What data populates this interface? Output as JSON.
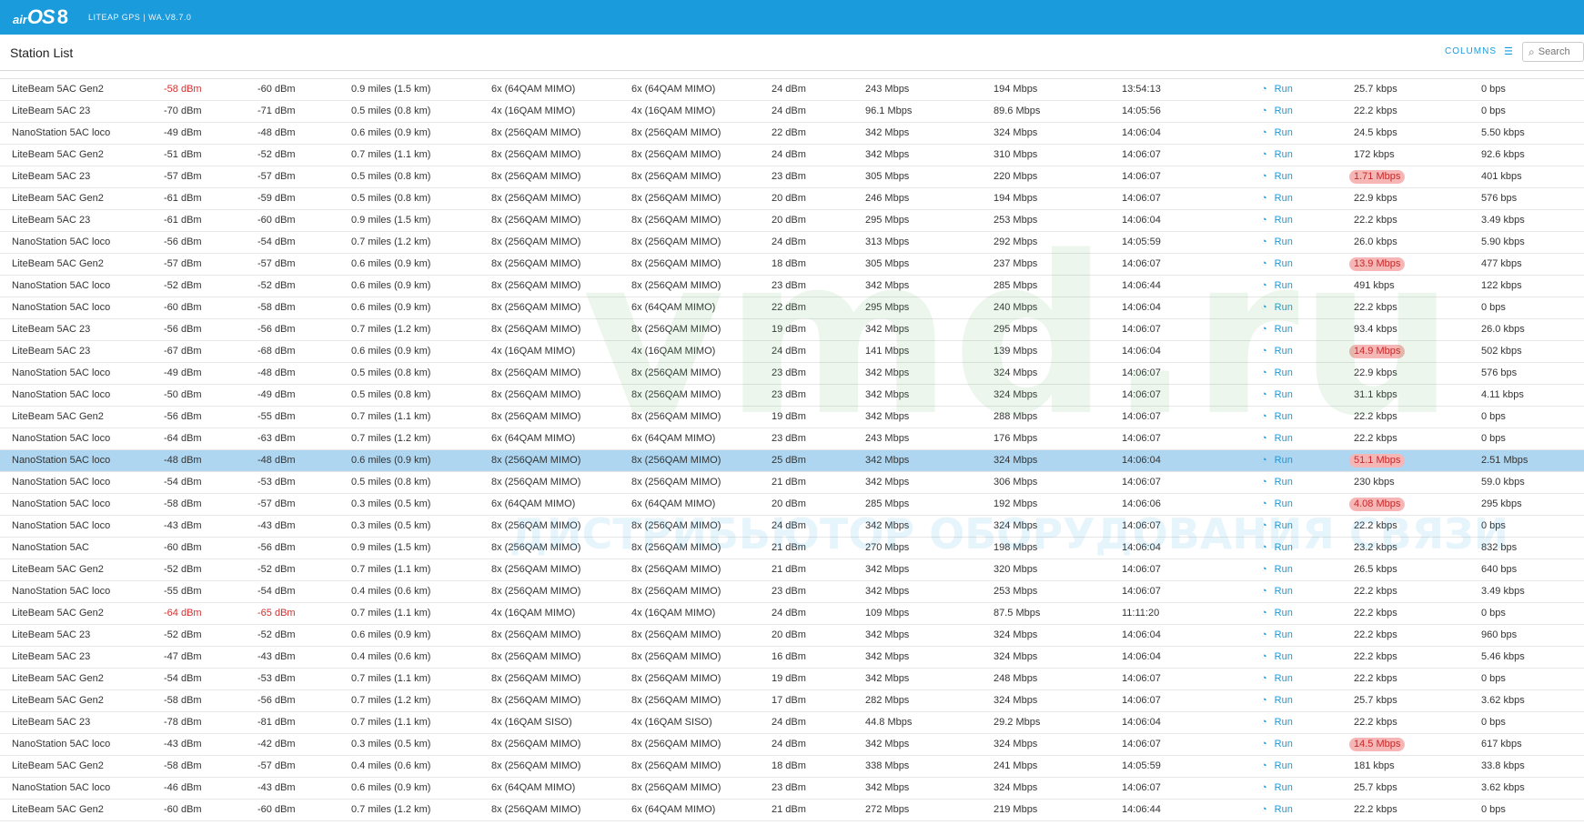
{
  "header": {
    "logo_brand": "air",
    "logo_os": "OS",
    "logo_version": "8",
    "product": "LITEAP GPS | WA.V8.7.0"
  },
  "page": {
    "title": "Station List",
    "columns_label": "COLUMNS",
    "search_placeholder": "Search"
  },
  "watermark": {
    "domain": "vmd.ru",
    "tagline": "ДИСТРИБЬЮТОР ОБОРУДОВАНИЯ СВЯЗИ"
  },
  "colors": {
    "accent": "#1a9bdc",
    "selected_row": "#aed6f1",
    "alert": "#d32f2f",
    "highlight_bg": "#f7b6b6"
  },
  "rows": [
    {
      "name": "LiteBeam 5AC Gen2",
      "sig": "-58 dBm",
      "rsig": "-60 dBm",
      "dist": "0.9 miles (1.5 km)",
      "rxm": "6x (64QAM MIMO)",
      "txm": "6x (64QAM MIMO)",
      "txp": "24 dBm",
      "txr": "243 Mbps",
      "rxr": "194 Mbps",
      "last": "13:54:13",
      "run": "Run",
      "thr": "25.7 kbps",
      "thr2": "0 bps",
      "sig_red": true,
      "rsig_red": false,
      "thr_hl": false,
      "selected": false
    },
    {
      "name": "LiteBeam 5AC 23",
      "sig": "-70 dBm",
      "rsig": "-71 dBm",
      "dist": "0.5 miles (0.8 km)",
      "rxm": "4x (16QAM MIMO)",
      "txm": "4x (16QAM MIMO)",
      "txp": "24 dBm",
      "txr": "96.1 Mbps",
      "rxr": "89.6 Mbps",
      "last": "14:05:56",
      "run": "Run",
      "thr": "22.2 kbps",
      "thr2": "0 bps",
      "sig_red": false,
      "rsig_red": false,
      "thr_hl": false,
      "selected": false
    },
    {
      "name": "NanoStation 5AC loco",
      "sig": "-49 dBm",
      "rsig": "-48 dBm",
      "dist": "0.6 miles (0.9 km)",
      "rxm": "8x (256QAM MIMO)",
      "txm": "8x (256QAM MIMO)",
      "txp": "22 dBm",
      "txr": "342 Mbps",
      "rxr": "324 Mbps",
      "last": "14:06:04",
      "run": "Run",
      "thr": "24.5 kbps",
      "thr2": "5.50 kbps",
      "sig_red": false,
      "rsig_red": false,
      "thr_hl": false,
      "selected": false
    },
    {
      "name": "LiteBeam 5AC Gen2",
      "sig": "-51 dBm",
      "rsig": "-52 dBm",
      "dist": "0.7 miles (1.1 km)",
      "rxm": "8x (256QAM MIMO)",
      "txm": "8x (256QAM MIMO)",
      "txp": "24 dBm",
      "txr": "342 Mbps",
      "rxr": "310 Mbps",
      "last": "14:06:07",
      "run": "Run",
      "thr": "172 kbps",
      "thr2": "92.6 kbps",
      "sig_red": false,
      "rsig_red": false,
      "thr_hl": false,
      "selected": false
    },
    {
      "name": "LiteBeam 5AC 23",
      "sig": "-57 dBm",
      "rsig": "-57 dBm",
      "dist": "0.5 miles (0.8 km)",
      "rxm": "8x (256QAM MIMO)",
      "txm": "8x (256QAM MIMO)",
      "txp": "23 dBm",
      "txr": "305 Mbps",
      "rxr": "220 Mbps",
      "last": "14:06:07",
      "run": "Run",
      "thr": "1.71 Mbps",
      "thr2": "401 kbps",
      "sig_red": false,
      "rsig_red": false,
      "thr_hl": true,
      "selected": false
    },
    {
      "name": "LiteBeam 5AC Gen2",
      "sig": "-61 dBm",
      "rsig": "-59 dBm",
      "dist": "0.5 miles (0.8 km)",
      "rxm": "8x (256QAM MIMO)",
      "txm": "8x (256QAM MIMO)",
      "txp": "20 dBm",
      "txr": "246 Mbps",
      "rxr": "194 Mbps",
      "last": "14:06:07",
      "run": "Run",
      "thr": "22.9 kbps",
      "thr2": "576 bps",
      "sig_red": false,
      "rsig_red": false,
      "thr_hl": false,
      "selected": false
    },
    {
      "name": "LiteBeam 5AC 23",
      "sig": "-61 dBm",
      "rsig": "-60 dBm",
      "dist": "0.9 miles (1.5 km)",
      "rxm": "8x (256QAM MIMO)",
      "txm": "8x (256QAM MIMO)",
      "txp": "20 dBm",
      "txr": "295 Mbps",
      "rxr": "253 Mbps",
      "last": "14:06:04",
      "run": "Run",
      "thr": "22.2 kbps",
      "thr2": "3.49 kbps",
      "sig_red": false,
      "rsig_red": false,
      "thr_hl": false,
      "selected": false
    },
    {
      "name": "NanoStation 5AC loco",
      "sig": "-56 dBm",
      "rsig": "-54 dBm",
      "dist": "0.7 miles (1.2 km)",
      "rxm": "8x (256QAM MIMO)",
      "txm": "8x (256QAM MIMO)",
      "txp": "24 dBm",
      "txr": "313 Mbps",
      "rxr": "292 Mbps",
      "last": "14:05:59",
      "run": "Run",
      "thr": "26.0 kbps",
      "thr2": "5.90 kbps",
      "sig_red": false,
      "rsig_red": false,
      "thr_hl": false,
      "selected": false
    },
    {
      "name": "LiteBeam 5AC Gen2",
      "sig": "-57 dBm",
      "rsig": "-57 dBm",
      "dist": "0.6 miles (0.9 km)",
      "rxm": "8x (256QAM MIMO)",
      "txm": "8x (256QAM MIMO)",
      "txp": "18 dBm",
      "txr": "305 Mbps",
      "rxr": "237 Mbps",
      "last": "14:06:07",
      "run": "Run",
      "thr": "13.9 Mbps",
      "thr2": "477 kbps",
      "sig_red": false,
      "rsig_red": false,
      "thr_hl": true,
      "selected": false
    },
    {
      "name": "NanoStation 5AC loco",
      "sig": "-52 dBm",
      "rsig": "-52 dBm",
      "dist": "0.6 miles (0.9 km)",
      "rxm": "8x (256QAM MIMO)",
      "txm": "8x (256QAM MIMO)",
      "txp": "23 dBm",
      "txr": "342 Mbps",
      "rxr": "285 Mbps",
      "last": "14:06:44",
      "run": "Run",
      "thr": "491 kbps",
      "thr2": "122 kbps",
      "sig_red": false,
      "rsig_red": false,
      "thr_hl": false,
      "selected": false
    },
    {
      "name": "NanoStation 5AC loco",
      "sig": "-60 dBm",
      "rsig": "-58 dBm",
      "dist": "0.6 miles (0.9 km)",
      "rxm": "8x (256QAM MIMO)",
      "txm": "6x (64QAM MIMO)",
      "txp": "22 dBm",
      "txr": "295 Mbps",
      "rxr": "240 Mbps",
      "last": "14:06:04",
      "run": "Run",
      "thr": "22.2 kbps",
      "thr2": "0 bps",
      "sig_red": false,
      "rsig_red": false,
      "thr_hl": false,
      "selected": false
    },
    {
      "name": "LiteBeam 5AC 23",
      "sig": "-56 dBm",
      "rsig": "-56 dBm",
      "dist": "0.7 miles (1.2 km)",
      "rxm": "8x (256QAM MIMO)",
      "txm": "8x (256QAM MIMO)",
      "txp": "19 dBm",
      "txr": "342 Mbps",
      "rxr": "295 Mbps",
      "last": "14:06:07",
      "run": "Run",
      "thr": "93.4 kbps",
      "thr2": "26.0 kbps",
      "sig_red": false,
      "rsig_red": false,
      "thr_hl": false,
      "selected": false
    },
    {
      "name": "LiteBeam 5AC 23",
      "sig": "-67 dBm",
      "rsig": "-68 dBm",
      "dist": "0.6 miles (0.9 km)",
      "rxm": "4x (16QAM MIMO)",
      "txm": "4x (16QAM MIMO)",
      "txp": "24 dBm",
      "txr": "141 Mbps",
      "rxr": "139 Mbps",
      "last": "14:06:04",
      "run": "Run",
      "thr": "14.9 Mbps",
      "thr2": "502 kbps",
      "sig_red": false,
      "rsig_red": false,
      "thr_hl": true,
      "selected": false
    },
    {
      "name": "NanoStation 5AC loco",
      "sig": "-49 dBm",
      "rsig": "-48 dBm",
      "dist": "0.5 miles (0.8 km)",
      "rxm": "8x (256QAM MIMO)",
      "txm": "8x (256QAM MIMO)",
      "txp": "23 dBm",
      "txr": "342 Mbps",
      "rxr": "324 Mbps",
      "last": "14:06:07",
      "run": "Run",
      "thr": "22.9 kbps",
      "thr2": "576 bps",
      "sig_red": false,
      "rsig_red": false,
      "thr_hl": false,
      "selected": false
    },
    {
      "name": "NanoStation 5AC loco",
      "sig": "-50 dBm",
      "rsig": "-49 dBm",
      "dist": "0.5 miles (0.8 km)",
      "rxm": "8x (256QAM MIMO)",
      "txm": "8x (256QAM MIMO)",
      "txp": "23 dBm",
      "txr": "342 Mbps",
      "rxr": "324 Mbps",
      "last": "14:06:07",
      "run": "Run",
      "thr": "31.1 kbps",
      "thr2": "4.11 kbps",
      "sig_red": false,
      "rsig_red": false,
      "thr_hl": false,
      "selected": false
    },
    {
      "name": "LiteBeam 5AC Gen2",
      "sig": "-56 dBm",
      "rsig": "-55 dBm",
      "dist": "0.7 miles (1.1 km)",
      "rxm": "8x (256QAM MIMO)",
      "txm": "8x (256QAM MIMO)",
      "txp": "19 dBm",
      "txr": "342 Mbps",
      "rxr": "288 Mbps",
      "last": "14:06:07",
      "run": "Run",
      "thr": "22.2 kbps",
      "thr2": "0 bps",
      "sig_red": false,
      "rsig_red": false,
      "thr_hl": false,
      "selected": false
    },
    {
      "name": "NanoStation 5AC loco",
      "sig": "-64 dBm",
      "rsig": "-63 dBm",
      "dist": "0.7 miles (1.2 km)",
      "rxm": "6x (64QAM MIMO)",
      "txm": "6x (64QAM MIMO)",
      "txp": "23 dBm",
      "txr": "243 Mbps",
      "rxr": "176 Mbps",
      "last": "14:06:07",
      "run": "Run",
      "thr": "22.2 kbps",
      "thr2": "0 bps",
      "sig_red": false,
      "rsig_red": false,
      "thr_hl": false,
      "selected": false
    },
    {
      "name": "NanoStation 5AC loco",
      "sig": "-48 dBm",
      "rsig": "-48 dBm",
      "dist": "0.6 miles (0.9 km)",
      "rxm": "8x (256QAM MIMO)",
      "txm": "8x (256QAM MIMO)",
      "txp": "25 dBm",
      "txr": "342 Mbps",
      "rxr": "324 Mbps",
      "last": "14:06:04",
      "run": "Run",
      "thr": "51.1 Mbps",
      "thr2": "2.51 Mbps",
      "sig_red": false,
      "rsig_red": false,
      "thr_hl": true,
      "selected": true
    },
    {
      "name": "NanoStation 5AC loco",
      "sig": "-54 dBm",
      "rsig": "-53 dBm",
      "dist": "0.5 miles (0.8 km)",
      "rxm": "8x (256QAM MIMO)",
      "txm": "8x (256QAM MIMO)",
      "txp": "21 dBm",
      "txr": "342 Mbps",
      "rxr": "306 Mbps",
      "last": "14:06:07",
      "run": "Run",
      "thr": "230 kbps",
      "thr2": "59.0 kbps",
      "sig_red": false,
      "rsig_red": false,
      "thr_hl": false,
      "selected": false
    },
    {
      "name": "NanoStation 5AC loco",
      "sig": "-58 dBm",
      "rsig": "-57 dBm",
      "dist": "0.3 miles (0.5 km)",
      "rxm": "6x (64QAM MIMO)",
      "txm": "6x (64QAM MIMO)",
      "txp": "20 dBm",
      "txr": "285 Mbps",
      "rxr": "192 Mbps",
      "last": "14:06:06",
      "run": "Run",
      "thr": "4.08 Mbps",
      "thr2": "295 kbps",
      "sig_red": false,
      "rsig_red": false,
      "thr_hl": true,
      "selected": false
    },
    {
      "name": "NanoStation 5AC loco",
      "sig": "-43 dBm",
      "rsig": "-43 dBm",
      "dist": "0.3 miles (0.5 km)",
      "rxm": "8x (256QAM MIMO)",
      "txm": "8x (256QAM MIMO)",
      "txp": "24 dBm",
      "txr": "342 Mbps",
      "rxr": "324 Mbps",
      "last": "14:06:07",
      "run": "Run",
      "thr": "22.2 kbps",
      "thr2": "0 bps",
      "sig_red": false,
      "rsig_red": false,
      "thr_hl": false,
      "selected": false
    },
    {
      "name": "NanoStation 5AC",
      "sig": "-60 dBm",
      "rsig": "-56 dBm",
      "dist": "0.9 miles (1.5 km)",
      "rxm": "8x (256QAM MIMO)",
      "txm": "8x (256QAM MIMO)",
      "txp": "21 dBm",
      "txr": "270 Mbps",
      "rxr": "198 Mbps",
      "last": "14:06:04",
      "run": "Run",
      "thr": "23.2 kbps",
      "thr2": "832 bps",
      "sig_red": false,
      "rsig_red": false,
      "thr_hl": false,
      "selected": false
    },
    {
      "name": "LiteBeam 5AC Gen2",
      "sig": "-52 dBm",
      "rsig": "-52 dBm",
      "dist": "0.7 miles (1.1 km)",
      "rxm": "8x (256QAM MIMO)",
      "txm": "8x (256QAM MIMO)",
      "txp": "21 dBm",
      "txr": "342 Mbps",
      "rxr": "320 Mbps",
      "last": "14:06:07",
      "run": "Run",
      "thr": "26.5 kbps",
      "thr2": "640 bps",
      "sig_red": false,
      "rsig_red": false,
      "thr_hl": false,
      "selected": false
    },
    {
      "name": "NanoStation 5AC loco",
      "sig": "-55 dBm",
      "rsig": "-54 dBm",
      "dist": "0.4 miles (0.6 km)",
      "rxm": "8x (256QAM MIMO)",
      "txm": "8x (256QAM MIMO)",
      "txp": "23 dBm",
      "txr": "342 Mbps",
      "rxr": "253 Mbps",
      "last": "14:06:07",
      "run": "Run",
      "thr": "22.2 kbps",
      "thr2": "3.49 kbps",
      "sig_red": false,
      "rsig_red": false,
      "thr_hl": false,
      "selected": false
    },
    {
      "name": "LiteBeam 5AC Gen2",
      "sig": "-64 dBm",
      "rsig": "-65 dBm",
      "dist": "0.7 miles (1.1 km)",
      "rxm": "4x (16QAM MIMO)",
      "txm": "4x (16QAM MIMO)",
      "txp": "24 dBm",
      "txr": "109 Mbps",
      "rxr": "87.5 Mbps",
      "last": "11:11:20",
      "run": "Run",
      "thr": "22.2 kbps",
      "thr2": "0 bps",
      "sig_red": true,
      "rsig_red": true,
      "thr_hl": false,
      "selected": false
    },
    {
      "name": "LiteBeam 5AC 23",
      "sig": "-52 dBm",
      "rsig": "-52 dBm",
      "dist": "0.6 miles (0.9 km)",
      "rxm": "8x (256QAM MIMO)",
      "txm": "8x (256QAM MIMO)",
      "txp": "20 dBm",
      "txr": "342 Mbps",
      "rxr": "324 Mbps",
      "last": "14:06:04",
      "run": "Run",
      "thr": "22.2 kbps",
      "thr2": "960 bps",
      "sig_red": false,
      "rsig_red": false,
      "thr_hl": false,
      "selected": false
    },
    {
      "name": "LiteBeam 5AC 23",
      "sig": "-47 dBm",
      "rsig": "-43 dBm",
      "dist": "0.4 miles (0.6 km)",
      "rxm": "8x (256QAM MIMO)",
      "txm": "8x (256QAM MIMO)",
      "txp": "16 dBm",
      "txr": "342 Mbps",
      "rxr": "324 Mbps",
      "last": "14:06:04",
      "run": "Run",
      "thr": "22.2 kbps",
      "thr2": "5.46 kbps",
      "sig_red": false,
      "rsig_red": false,
      "thr_hl": false,
      "selected": false
    },
    {
      "name": "LiteBeam 5AC Gen2",
      "sig": "-54 dBm",
      "rsig": "-53 dBm",
      "dist": "0.7 miles (1.1 km)",
      "rxm": "8x (256QAM MIMO)",
      "txm": "8x (256QAM MIMO)",
      "txp": "19 dBm",
      "txr": "342 Mbps",
      "rxr": "248 Mbps",
      "last": "14:06:07",
      "run": "Run",
      "thr": "22.2 kbps",
      "thr2": "0 bps",
      "sig_red": false,
      "rsig_red": false,
      "thr_hl": false,
      "selected": false
    },
    {
      "name": "LiteBeam 5AC Gen2",
      "sig": "-58 dBm",
      "rsig": "-56 dBm",
      "dist": "0.7 miles (1.2 km)",
      "rxm": "8x (256QAM MIMO)",
      "txm": "8x (256QAM MIMO)",
      "txp": "17 dBm",
      "txr": "282 Mbps",
      "rxr": "324 Mbps",
      "last": "14:06:07",
      "run": "Run",
      "thr": "25.7 kbps",
      "thr2": "3.62 kbps",
      "sig_red": false,
      "rsig_red": false,
      "thr_hl": false,
      "selected": false
    },
    {
      "name": "LiteBeam 5AC 23",
      "sig": "-78 dBm",
      "rsig": "-81 dBm",
      "dist": "0.7 miles (1.1 km)",
      "rxm": "4x (16QAM SISO)",
      "txm": "4x (16QAM SISO)",
      "txp": "24 dBm",
      "txr": "44.8 Mbps",
      "rxr": "29.2 Mbps",
      "last": "14:06:04",
      "run": "Run",
      "thr": "22.2 kbps",
      "thr2": "0 bps",
      "sig_red": false,
      "rsig_red": false,
      "thr_hl": false,
      "selected": false
    },
    {
      "name": "NanoStation 5AC loco",
      "sig": "-43 dBm",
      "rsig": "-42 dBm",
      "dist": "0.3 miles (0.5 km)",
      "rxm": "8x (256QAM MIMO)",
      "txm": "8x (256QAM MIMO)",
      "txp": "24 dBm",
      "txr": "342 Mbps",
      "rxr": "324 Mbps",
      "last": "14:06:07",
      "run": "Run",
      "thr": "14.5 Mbps",
      "thr2": "617 kbps",
      "sig_red": false,
      "rsig_red": false,
      "thr_hl": true,
      "selected": false
    },
    {
      "name": "LiteBeam 5AC Gen2",
      "sig": "-58 dBm",
      "rsig": "-57 dBm",
      "dist": "0.4 miles (0.6 km)",
      "rxm": "8x (256QAM MIMO)",
      "txm": "8x (256QAM MIMO)",
      "txp": "18 dBm",
      "txr": "338 Mbps",
      "rxr": "241 Mbps",
      "last": "14:05:59",
      "run": "Run",
      "thr": "181 kbps",
      "thr2": "33.8 kbps",
      "sig_red": false,
      "rsig_red": false,
      "thr_hl": false,
      "selected": false
    },
    {
      "name": "NanoStation 5AC loco",
      "sig": "-46 dBm",
      "rsig": "-43 dBm",
      "dist": "0.6 miles (0.9 km)",
      "rxm": "6x (64QAM MIMO)",
      "txm": "8x (256QAM MIMO)",
      "txp": "23 dBm",
      "txr": "342 Mbps",
      "rxr": "324 Mbps",
      "last": "14:06:07",
      "run": "Run",
      "thr": "25.7 kbps",
      "thr2": "3.62 kbps",
      "sig_red": false,
      "rsig_red": false,
      "thr_hl": false,
      "selected": false
    },
    {
      "name": "LiteBeam 5AC Gen2",
      "sig": "-60 dBm",
      "rsig": "-60 dBm",
      "dist": "0.7 miles (1.2 km)",
      "rxm": "8x (256QAM MIMO)",
      "txm": "6x (64QAM MIMO)",
      "txp": "21 dBm",
      "txr": "272 Mbps",
      "rxr": "219 Mbps",
      "last": "14:06:44",
      "run": "Run",
      "thr": "22.2 kbps",
      "thr2": "0 bps",
      "sig_red": false,
      "rsig_red": false,
      "thr_hl": false,
      "selected": false
    }
  ]
}
